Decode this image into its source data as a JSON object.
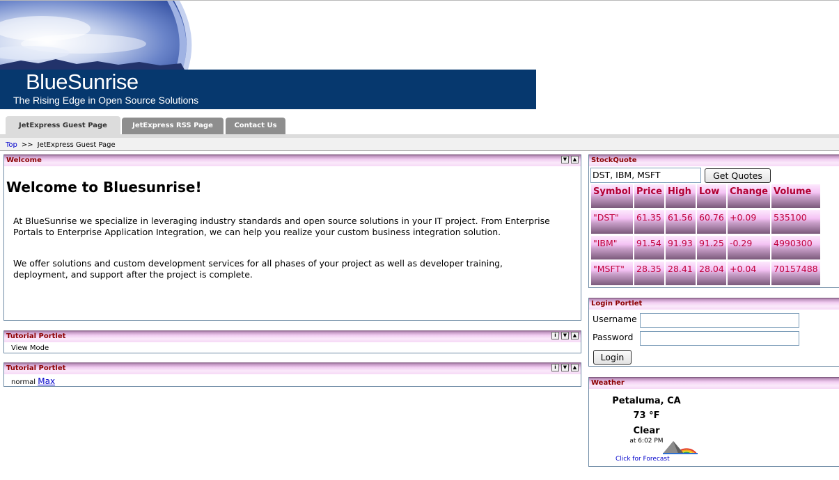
{
  "banner": {
    "brand": "BlueSunrise",
    "tagline": "The Rising Edge in Open Source Solutions"
  },
  "tabs": [
    {
      "label": "JetExpress Guest Page",
      "active": true
    },
    {
      "label": "JetExpress RSS Page",
      "active": false
    },
    {
      "label": "Contact Us",
      "active": false
    }
  ],
  "breadcrumb": {
    "top": "Top",
    "separator": ">>",
    "current": "JetExpress Guest Page"
  },
  "welcome": {
    "title": "Welcome",
    "heading": "Welcome to Bluesunrise!",
    "para1": "At BlueSunrise we specialize in leveraging industry standards and open source solutions in your IT project. From Enterprise Portals to Enterprise Application Integration, we can help you realize your custom business integration solution.",
    "para2": "We offer solutions and custom development services for all phases of your project as well as developer training, deployment, and support after the project is complete."
  },
  "tutorial1": {
    "title": "Tutorial Portlet",
    "body": "View Mode"
  },
  "tutorial2": {
    "title": "Tutorial Portlet",
    "body": "normal",
    "link": "Max"
  },
  "stockquote": {
    "title": "StockQuote",
    "input_value": "DST, IBM, MSFT",
    "button": "Get Quotes",
    "headers": [
      "Symbol",
      "Price",
      "High",
      "Low",
      "Change",
      "Volume"
    ],
    "rows": [
      [
        "\"DST\"",
        "61.35",
        "61.56",
        "60.76",
        "+0.09",
        "535100"
      ],
      [
        "\"IBM\"",
        "91.54",
        "91.93",
        "91.25",
        "-0.29",
        "4990300"
      ],
      [
        "\"MSFT\"",
        "28.35",
        "28.41",
        "28.04",
        "+0.04",
        "70157488"
      ]
    ]
  },
  "login": {
    "title": "Login Portlet",
    "username_label": "Username",
    "password_label": "Password",
    "button": "Login"
  },
  "weather": {
    "title": "Weather",
    "city": "Petaluma, CA",
    "temp": "73 °F",
    "condition": "Clear",
    "time": "at 6:02 PM",
    "link": "Click for Forecast"
  },
  "colors": {
    "banner_bg": "#06386e",
    "portlet_title_text": "#8b0000",
    "quote_text": "#c0003a",
    "link": "#0000cc"
  }
}
